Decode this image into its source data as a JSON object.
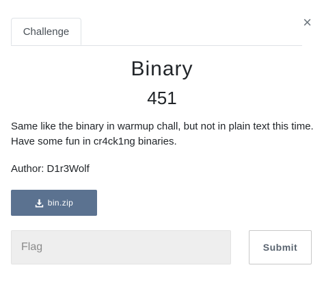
{
  "tabs": [
    {
      "label": "Challenge",
      "active": true
    }
  ],
  "close_symbol": "×",
  "challenge": {
    "name": "Binary",
    "value": "451",
    "description": "Same like the binary in warmup chall, but not in plain text this time. Have some fun in cr4ck1ng binaries.",
    "author": "Author: D1r3Wolf"
  },
  "file": {
    "icon": "download-icon",
    "name": "bin.zip"
  },
  "form": {
    "flag_placeholder": "Flag",
    "flag_value": "",
    "submit_label": "Submit"
  },
  "colors": {
    "download_button": "#5b7290",
    "flag_input_bg": "#eeeeee"
  }
}
